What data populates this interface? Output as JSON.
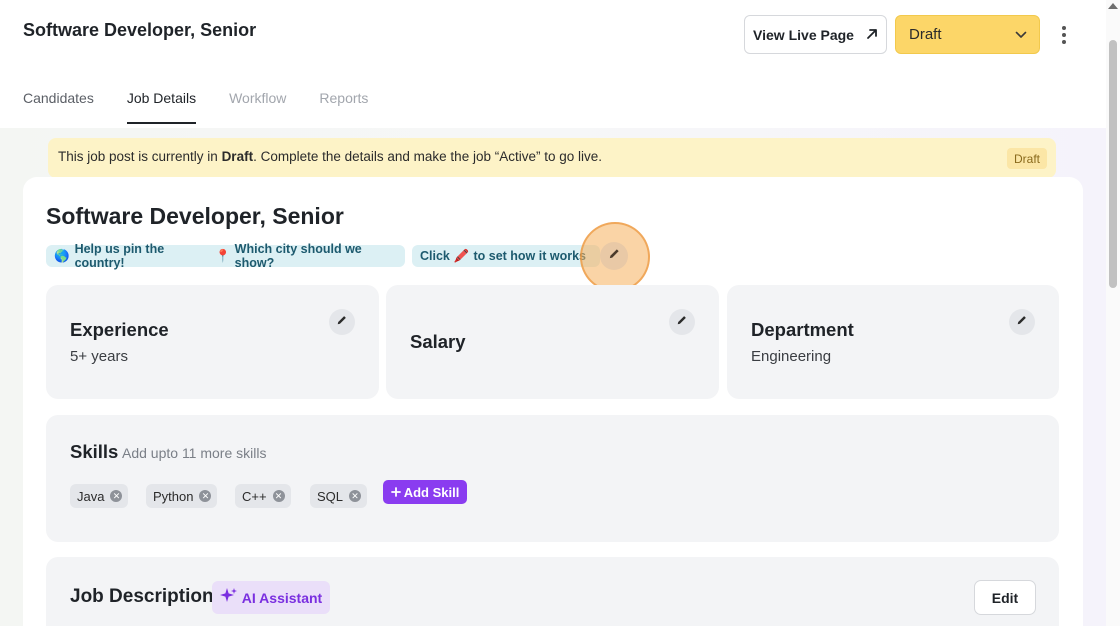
{
  "header": {
    "job_title": "Software Developer, Senior",
    "view_live_label": "View Live Page",
    "status_value": "Draft"
  },
  "tabs": [
    {
      "label": "Candidates"
    },
    {
      "label": "Job Details"
    },
    {
      "label": "Workflow"
    },
    {
      "label": "Reports"
    }
  ],
  "banner": {
    "prefix": "This job post is currently in ",
    "status": "Draft",
    "suffix": ". Complete the details and make the job “Active” to go live.",
    "badge": "Draft"
  },
  "job": {
    "title": "Software Developer, Senior",
    "location_chip": {
      "globe": "🌎",
      "text1": "Help us pin the country!",
      "pin": "📍",
      "text2": "Which city should we show?"
    },
    "work_mode_chip": {
      "text1": "Click",
      "pencil": "🖍️",
      "text2": "to set how it works"
    }
  },
  "info_cards": [
    {
      "label": "Experience",
      "value": "5+ years"
    },
    {
      "label": "Salary",
      "value": ""
    },
    {
      "label": "Department",
      "value": "Engineering"
    }
  ],
  "skills": {
    "title": "Skills",
    "hint": "Add upto 11 more skills",
    "items": [
      "Java",
      "Python",
      "C++",
      "SQL"
    ],
    "add_label": "Add Skill"
  },
  "job_description": {
    "title": "Job Description",
    "ai_label": "AI Assistant",
    "edit_label": "Edit"
  },
  "colors": {
    "status_yellow": "#fcd668",
    "banner_bg": "#fdf3c7",
    "accent_purple": "#8a3cf0",
    "chip_teal_bg": "#dcf0f4",
    "highlight_orange": "#f6b05c"
  }
}
